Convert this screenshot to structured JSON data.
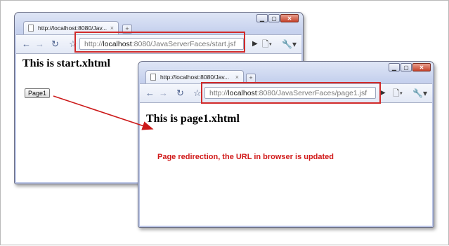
{
  "window_start": {
    "tab_title": "http://localhost:8080/Jav...",
    "tab_close": "×",
    "newtab": "+",
    "url_scheme_host_prefix": "http://",
    "url_host": "localhost",
    "url_rest": ":8080/JavaServerFaces/start.jsf",
    "heading": "This is start.xhtml",
    "button_label": "Page1"
  },
  "window_page1": {
    "tab_title": "http://localhost:8080/Jav...",
    "tab_close": "×",
    "newtab": "+",
    "url_scheme_host_prefix": "http://",
    "url_host": "localhost",
    "url_rest": ":8080/JavaServerFaces/page1.jsf",
    "heading": "This is page1.xhtml",
    "annotation": "Page redirection, the URL in browser is updated"
  },
  "icons": {
    "back": "back-icon",
    "forward": "forward-icon",
    "reload": "reload-icon",
    "star": "star-icon",
    "go": "play-icon",
    "page_menu": "page-icon",
    "wrench": "wrench-icon",
    "minimize": "minimize-icon",
    "maximize": "maximize-icon",
    "close": "close-icon"
  },
  "colors": {
    "highlight": "#d12a2a",
    "annotation": "#d11a1a",
    "arrow": "#cc1a1a"
  }
}
